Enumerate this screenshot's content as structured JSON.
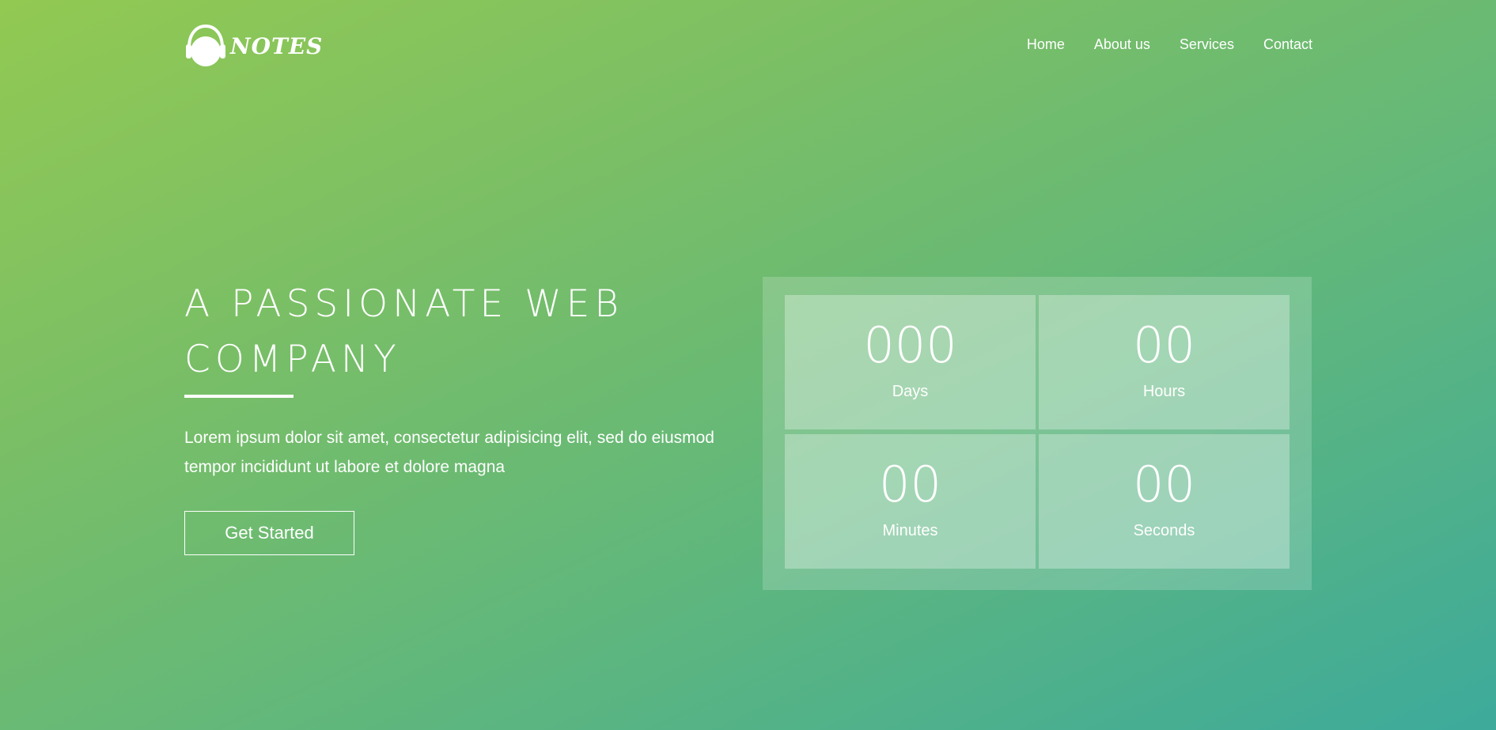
{
  "brand": {
    "name": "NOTES",
    "icon": "headphones-icon"
  },
  "nav": {
    "items": [
      {
        "label": "Home"
      },
      {
        "label": "About us"
      },
      {
        "label": "Services"
      },
      {
        "label": "Contact"
      }
    ]
  },
  "hero": {
    "title": "A PASSIONATE WEB COMPANY",
    "description": "Lorem ipsum dolor sit amet, consectetur adipisicing elit, sed do eiusmod tempor incididunt ut labore et dolore magna",
    "button_label": "Get Started"
  },
  "countdown": {
    "days": {
      "value": "000",
      "label": "Days"
    },
    "hours": {
      "value": "00",
      "label": "Hours"
    },
    "minutes": {
      "value": "00",
      "label": "Minutes"
    },
    "seconds": {
      "value": "00",
      "label": "Seconds"
    }
  },
  "colors": {
    "gradient_start": "#92c952",
    "gradient_end": "#3daa9b",
    "text": "#ffffff"
  }
}
